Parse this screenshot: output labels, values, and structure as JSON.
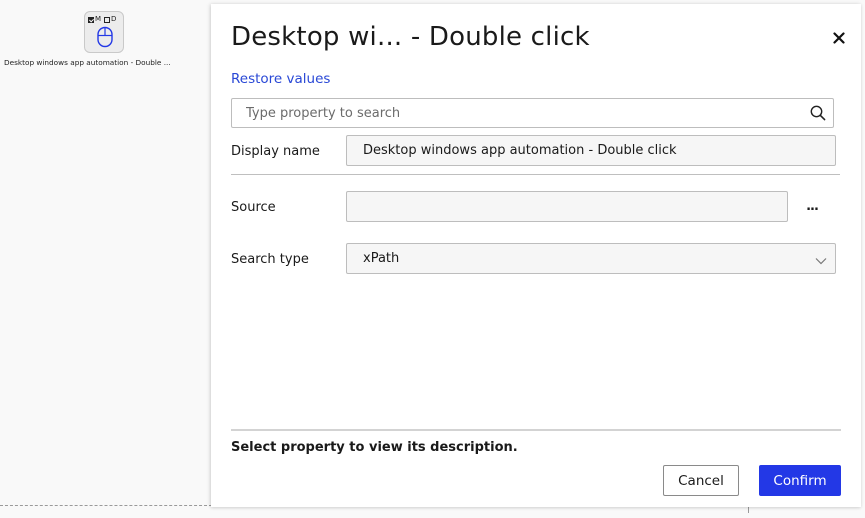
{
  "canvas": {
    "node": {
      "flags": [
        "M",
        "D"
      ],
      "flag_checked": [
        true,
        false
      ],
      "icon": "mouse-icon",
      "label": "Desktop windows app automation - Double ..."
    }
  },
  "panel": {
    "title": "Desktop wi... - Double click",
    "close_icon": "close-icon",
    "restore_label": "Restore values",
    "search": {
      "placeholder": "Type property to search",
      "value": "",
      "icon": "search-icon"
    },
    "properties": {
      "display_name": {
        "label": "Display name",
        "value": "Desktop windows app automation - Double click"
      },
      "source": {
        "label": "Source",
        "value": "",
        "more_label": "..."
      },
      "search_type": {
        "label": "Search type",
        "value": "xPath"
      }
    },
    "description": "Select property to view its description.",
    "buttons": {
      "cancel": "Cancel",
      "confirm": "Confirm"
    }
  },
  "colors": {
    "accent": "#2338e6",
    "link": "#2948d6",
    "field_bg": "#f6f6f6",
    "canvas_bg": "#f9f9f9"
  }
}
